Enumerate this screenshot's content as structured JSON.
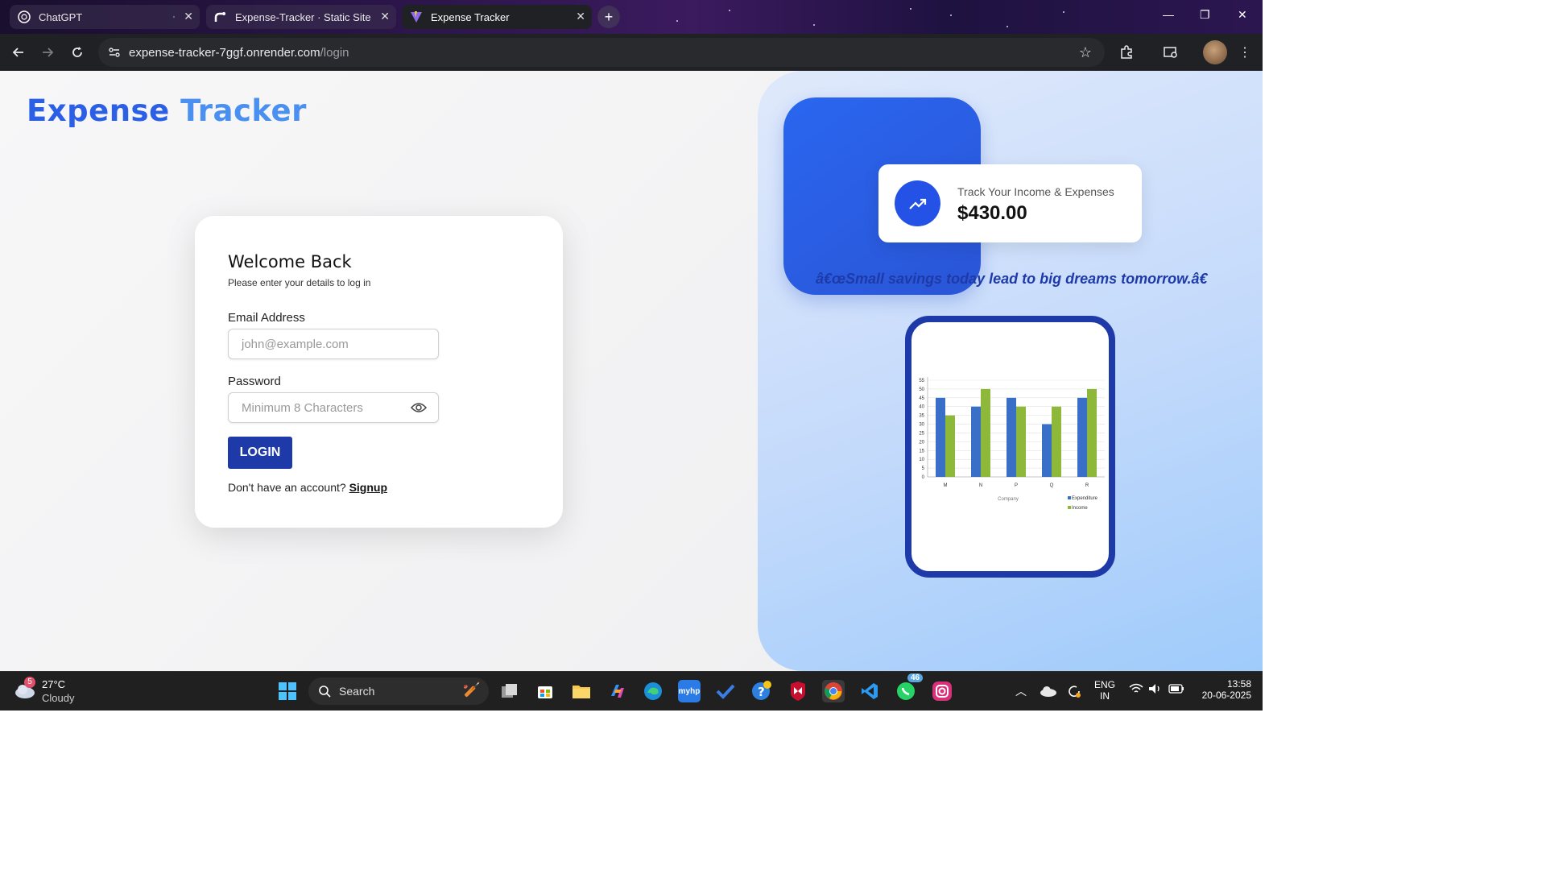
{
  "browser": {
    "tabs": [
      {
        "title": "ChatGPT",
        "icon": "openai-icon"
      },
      {
        "title": "Expense-Tracker · Static Site · [",
        "icon": "render-icon"
      },
      {
        "title": "Expense Tracker",
        "icon": "vite-icon"
      }
    ],
    "url_domain": "expense-tracker-7ggf.onrender.com",
    "url_path": "/login"
  },
  "app": {
    "brand_part1": "Expense",
    "brand_part2": "Tracker",
    "login_card": {
      "title": "Welcome Back",
      "subtitle": "Please enter your details to log in",
      "email_label": "Email Address",
      "email_placeholder": "john@example.com",
      "password_label": "Password",
      "password_placeholder": "Minimum 8 Characters",
      "login_button": "LOGIN",
      "signup_prompt": "Don't have an account?",
      "signup_link": "Signup"
    },
    "stat_card": {
      "label": "Track Your Income & Expenses",
      "amount": "$430.00"
    },
    "quote": "â€œSmall savings today lead to big dreams tomorrow.â€",
    "colors": {
      "primary": "#1e3aa8",
      "accent": "#2452e6",
      "income": "#8db83a",
      "expenditure": "#3a6fc8"
    }
  },
  "chart_data": {
    "type": "bar",
    "categories": [
      "M",
      "N",
      "P",
      "Q",
      "R"
    ],
    "series": [
      {
        "name": "Expenditure",
        "values": [
          45,
          40,
          45,
          30,
          45
        ]
      },
      {
        "name": "Income",
        "values": [
          35,
          50,
          40,
          40,
          50
        ]
      }
    ],
    "xlabel": "Company",
    "ylim": [
      0,
      55
    ],
    "yticks": [
      0,
      5,
      10,
      15,
      20,
      25,
      30,
      35,
      40,
      45,
      50,
      55
    ],
    "legend": "bottom-right"
  },
  "taskbar": {
    "weather_temp": "27°C",
    "weather_desc": "Cloudy",
    "weather_badge": "5",
    "search_label": "Search",
    "whatsapp_badge": "46",
    "lang_top": "ENG",
    "lang_bottom": "IN",
    "time": "13:58",
    "date": "20-06-2025"
  }
}
